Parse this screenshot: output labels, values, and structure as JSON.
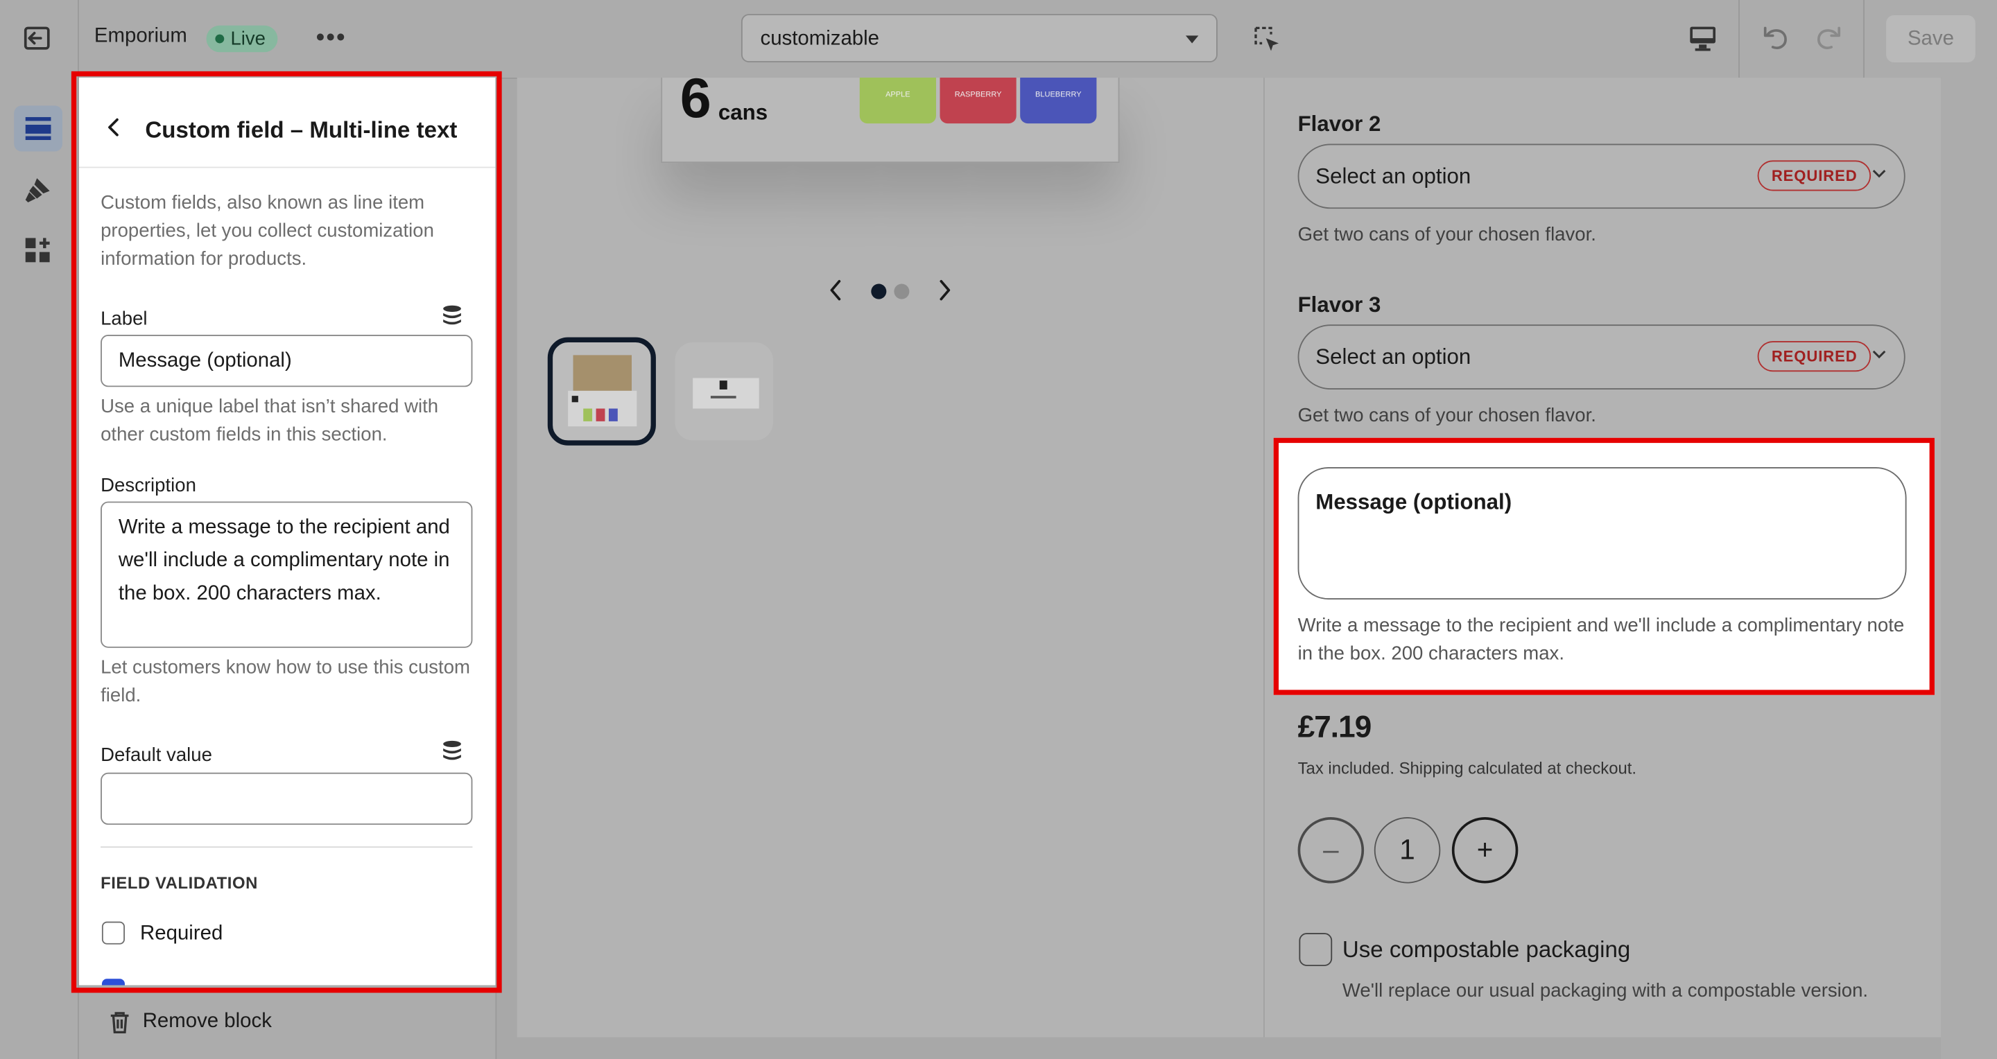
{
  "topbar": {
    "store_name": "Emporium",
    "live_label": "Live",
    "template_select": "customizable",
    "save_label": "Save",
    "colors": {
      "live_badge": "#87b89f",
      "save_disabled": "#b9b9b9"
    }
  },
  "panel": {
    "title": "Custom field – Multi-line text",
    "intro": "Custom fields, also known as line item properties, let you collect customization information for products.",
    "label_caption": "Label",
    "label_value": "Message (optional)",
    "label_help": "Use a unique label that isn’t shared with other custom fields in this section.",
    "description_caption": "Description",
    "description_value": "Write a message to the recipient and we'll include a complimentary note in the box. 200 characters max.",
    "description_help": "Let customers know how to use this custom field.",
    "default_caption": "Default value",
    "default_value": "",
    "validation_heading": "FIELD VALIDATION",
    "required_label": "Required",
    "remove_label": "Remove block"
  },
  "preview": {
    "pack_number": "6",
    "pack_unit": "cans",
    "can_labels": [
      "APPLE",
      "RASPBERRY",
      "BLUEBERRY"
    ],
    "can_colors": [
      "#9fc15a",
      "#c0424f",
      "#4b55b8"
    ],
    "gallery_active_index": 0,
    "flavor2_label": "Flavor 2",
    "flavor2_placeholder": "Select an option",
    "flavor2_badge": "REQUIRED",
    "flavor2_help": "Get two cans of your chosen flavor.",
    "flavor3_label": "Flavor 3",
    "flavor3_placeholder": "Select an option",
    "flavor3_badge": "REQUIRED",
    "flavor3_help": "Get two cans of your chosen flavor.",
    "message_label": "Message (optional)",
    "message_help": "Write a message to the recipient and we'll include a complimentary note in the box. 200 characters max.",
    "price": "£7.19",
    "tax_note": "Tax included. Shipping calculated at checkout.",
    "qty_minus": "–",
    "qty_value": "1",
    "qty_plus": "+",
    "compost_label": "Use compostable packaging",
    "compost_help": "We'll replace our usual packaging with a compostable version."
  },
  "highlight_color": "#e60000"
}
